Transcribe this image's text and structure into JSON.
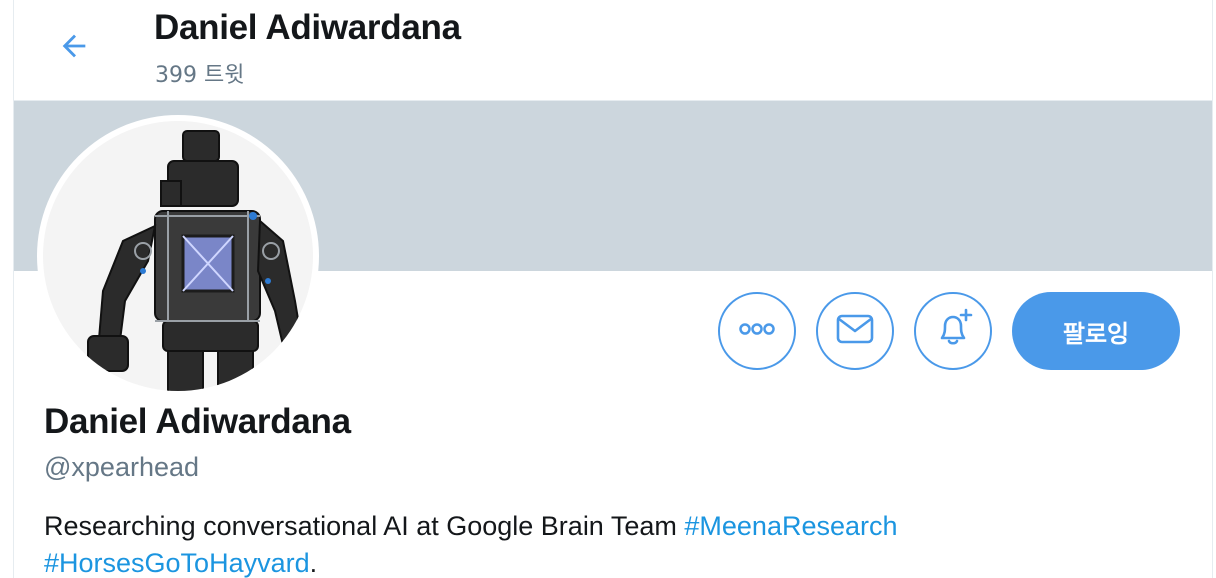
{
  "header": {
    "name": "Daniel Adiwardana",
    "tweet_count": "399 트윗"
  },
  "profile": {
    "name": "Daniel Adiwardana",
    "handle": "@xpearhead",
    "bio_text": "Researching conversational AI at Google Brain Team",
    "bio_hashtag_1": "#MeenaResearch",
    "bio_hashtag_2": "#HorsesGoToHayvard",
    "bio_end": "."
  },
  "actions": {
    "follow_label": "팔로잉"
  },
  "icons": {
    "back": "arrow-left-icon",
    "more": "more-horizontal-icon",
    "message": "envelope-icon",
    "notify": "bell-plus-icon"
  },
  "colors": {
    "accent": "#4a99e9",
    "link": "#1b95e0",
    "banner": "#ccd6dd",
    "secondary_text": "#657786"
  }
}
